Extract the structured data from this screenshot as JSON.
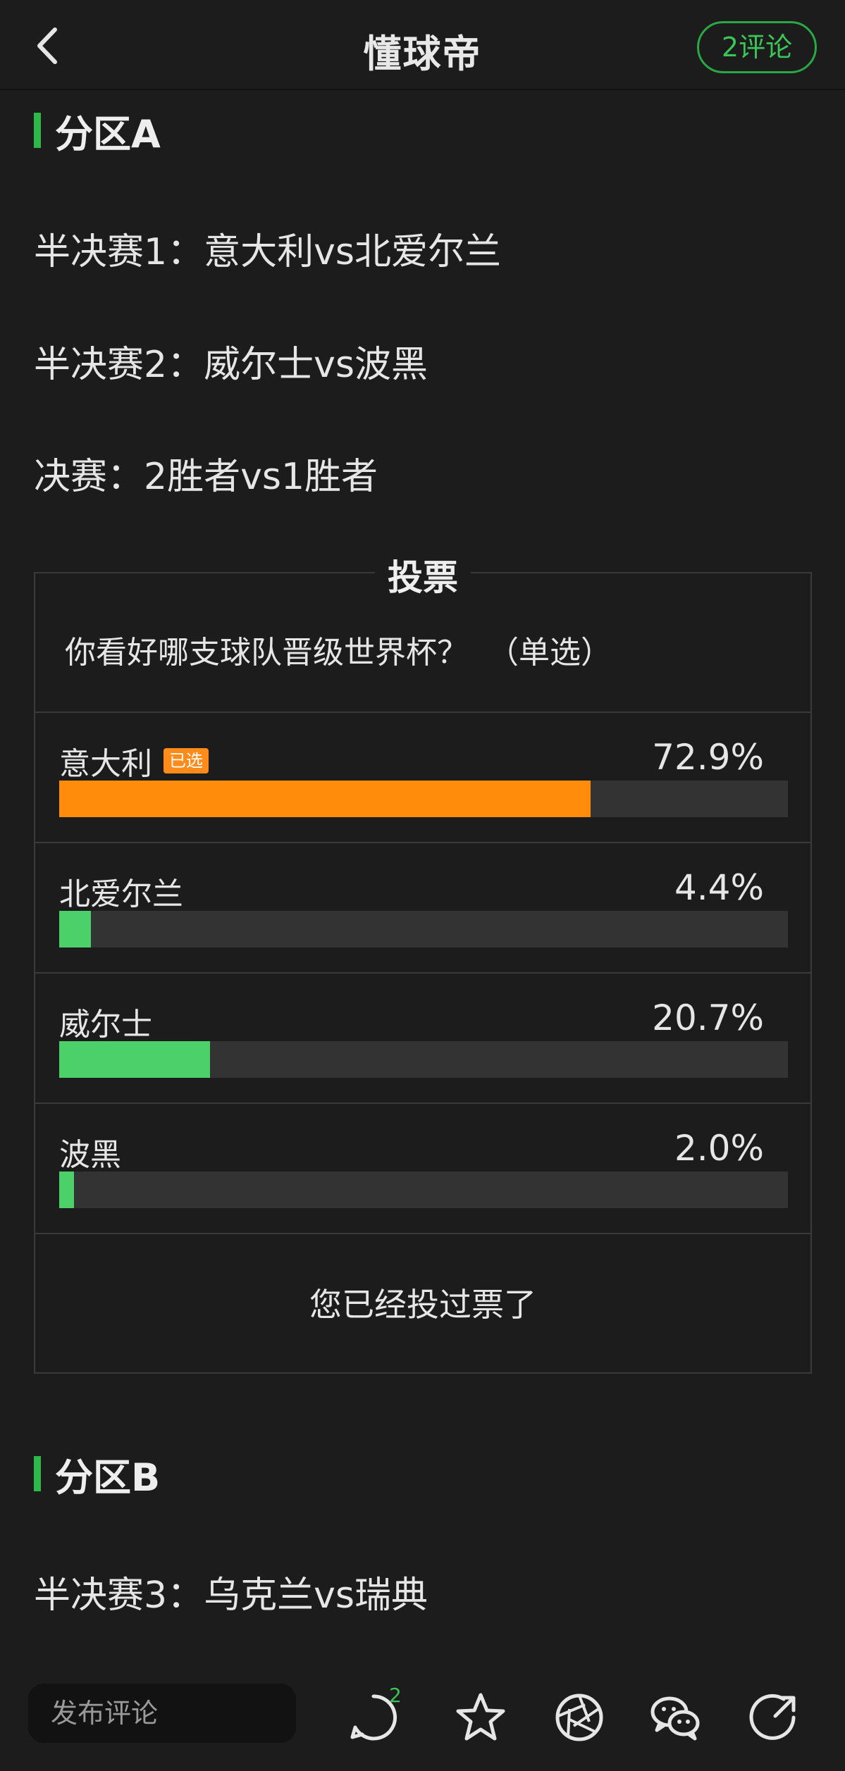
{
  "header": {
    "title": "懂球帝",
    "comments_label": "2评论"
  },
  "sections": [
    {
      "title": "分区A",
      "matches": [
        "半决赛1：意大利vs北爱尔兰",
        "半决赛2：威尔士vs波黑",
        "决赛：2胜者vs1胜者"
      ]
    },
    {
      "title": "分区B",
      "matches": [
        "半决赛3：乌克兰vs瑞典"
      ]
    }
  ],
  "poll": {
    "title": "投票",
    "question": "你看好哪支球队晋级世界杯？  （单选）",
    "options": [
      {
        "label": "意大利",
        "badge": "已选",
        "percent_text": "72.9%",
        "percent": 72.9,
        "selected": true
      },
      {
        "label": "北爱尔兰",
        "percent_text": "4.4%",
        "percent": 4.4,
        "selected": false
      },
      {
        "label": "威尔士",
        "percent_text": "20.7%",
        "percent": 20.7,
        "selected": false
      },
      {
        "label": "波黑",
        "percent_text": "2.0%",
        "percent": 2.0,
        "selected": false
      }
    ],
    "voted_message": "您已经投过票了"
  },
  "bottom_bar": {
    "comment_placeholder": "发布评论",
    "comment_count": "2",
    "icons": [
      "comment-icon",
      "star-icon",
      "aperture-icon",
      "wechat-icon",
      "share-icon"
    ]
  },
  "colors": {
    "background": "#1c1c1c",
    "accent_green": "#2fb84a",
    "bar_green": "#4cd06a",
    "bar_orange": "#ff8c0a",
    "track": "#333333"
  }
}
